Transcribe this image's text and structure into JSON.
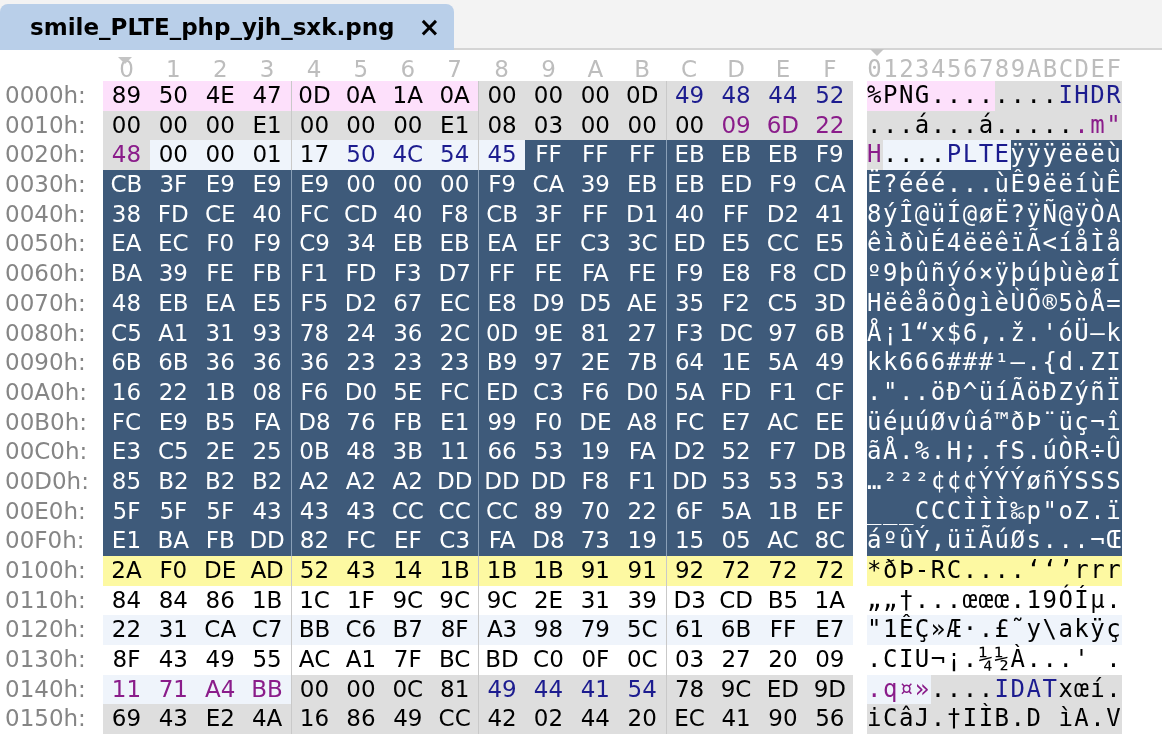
{
  "tab": {
    "title": "smile_PLTE_php_yjh_sxk.png",
    "close": "×",
    "selected": true
  },
  "column_header": {
    "hex": [
      "0",
      "1",
      "2",
      "3",
      "4",
      "5",
      "6",
      "7",
      "8",
      "9",
      "A",
      "B",
      "C",
      "D",
      "E",
      "F"
    ],
    "ascii": "0123456789ABCDEF"
  },
  "rows": [
    {
      "offset": "0000h:",
      "segments": [
        {
          "color": "#fde0fb",
          "selected": false,
          "kind": "plain",
          "bytes": "89 50 4E 47 0D 0A 1A 0A",
          "ascii": "%PNG...."
        },
        {
          "color": "#dedede",
          "selected": false,
          "kind": "plain",
          "bytes": "00 00 00 0D",
          "ascii": "...."
        },
        {
          "color": "#dedede",
          "selected": false,
          "kind": "type",
          "bytes": "49 48 44 52",
          "ascii": "IHDR"
        }
      ]
    },
    {
      "offset": "0010h:",
      "segments": [
        {
          "color": "#dedede",
          "selected": false,
          "kind": "plain",
          "bytes": "00 00 00 E1 00 00 00 E1 08 03 00 00 00",
          "ascii": "...á...á....."
        },
        {
          "color": "#dedede",
          "selected": false,
          "kind": "crc",
          "bytes": "09 6D 22",
          "ascii": ".m\""
        }
      ]
    },
    {
      "offset": "0020h:",
      "segments": [
        {
          "color": "#dedede",
          "selected": false,
          "kind": "crc",
          "bytes": "48",
          "ascii": "H"
        },
        {
          "color": "#eff4fb",
          "selected": false,
          "kind": "plain",
          "bytes": "00 00 01 17",
          "ascii": "...."
        },
        {
          "color": "#eff4fb",
          "selected": false,
          "kind": "type",
          "bytes": "50 4C 54 45",
          "ascii": "PLTE"
        },
        {
          "color": "#3e5a7a",
          "selected": true,
          "kind": "plain",
          "bytes": "FF FF FF EB EB EB F9",
          "ascii": "ÿÿÿëëëù"
        }
      ]
    },
    {
      "offset": "0030h:",
      "segments": [
        {
          "color": "#3e5a7a",
          "selected": true,
          "kind": "plain",
          "bytes": "CB 3F E9 E9 E9 00 00 00 F9 CA 39 EB EB ED F9 CA",
          "ascii": "Ë?ééé...ùÊ9ëëíùÊ"
        }
      ]
    },
    {
      "offset": "0040h:",
      "segments": [
        {
          "color": "#3e5a7a",
          "selected": true,
          "kind": "plain",
          "bytes": "38 FD CE 40 FC CD 40 F8 CB 3F FF D1 40 FF D2 41",
          "ascii": "8ýÎ@üÍ@øË?ÿÑ@ÿÒA"
        }
      ]
    },
    {
      "offset": "0050h:",
      "segments": [
        {
          "color": "#3e5a7a",
          "selected": true,
          "kind": "plain",
          "bytes": "EA EC F0 F9 C9 34 EB EB EA EF C3 3C ED E5 CC E5",
          "ascii": "êìðùÉ4ëëêïÃ<íåÌå"
        }
      ]
    },
    {
      "offset": "0060h:",
      "segments": [
        {
          "color": "#3e5a7a",
          "selected": true,
          "kind": "plain",
          "bytes": "BA 39 FE FB F1 FD F3 D7 FF FE FA FE F9 E8 F8 CD",
          "ascii": "º9þûñýó×ÿþúþùèøÍ"
        }
      ]
    },
    {
      "offset": "0070h:",
      "segments": [
        {
          "color": "#3e5a7a",
          "selected": true,
          "kind": "plain",
          "bytes": "48 EB EA E5 F5 D2 67 EC E8 D9 D5 AE 35 F2 C5 3D",
          "ascii": "HëêåõÒgìèÙÕ®5òÅ="
        }
      ]
    },
    {
      "offset": "0080h:",
      "segments": [
        {
          "color": "#3e5a7a",
          "selected": true,
          "kind": "plain",
          "bytes": "C5 A1 31 93 78 24 36 2C 0D 9E 81 27 F3 DC 97 6B",
          "ascii": "Å¡1“x$6,.ž.'óÜ—k"
        }
      ]
    },
    {
      "offset": "0090h:",
      "segments": [
        {
          "color": "#3e5a7a",
          "selected": true,
          "kind": "plain",
          "bytes": "6B 6B 36 36 36 23 23 23 B9 97 2E 7B 64 1E 5A 49",
          "ascii": "kk666###¹—.{d.ZI"
        }
      ]
    },
    {
      "offset": "00A0h:",
      "segments": [
        {
          "color": "#3e5a7a",
          "selected": true,
          "kind": "plain",
          "bytes": "16 22 1B 08 F6 D0 5E FC ED C3 F6 D0 5A FD F1 CF",
          "ascii": ".\"..öÐ^üíÃöÐZýñÏ"
        }
      ]
    },
    {
      "offset": "00B0h:",
      "segments": [
        {
          "color": "#3e5a7a",
          "selected": true,
          "kind": "plain",
          "bytes": "FC E9 B5 FA D8 76 FB E1 99 F0 DE A8 FC E7 AC EE",
          "ascii": "üéµúØvûá™ðÞ¨üç¬î"
        }
      ]
    },
    {
      "offset": "00C0h:",
      "segments": [
        {
          "color": "#3e5a7a",
          "selected": true,
          "kind": "plain",
          "bytes": "E3 C5 2E 25 0B 48 3B 11 66 53 19 FA D2 52 F7 DB",
          "ascii": "ãÅ.%.H;.fS.úÒR÷Û"
        }
      ]
    },
    {
      "offset": "00D0h:",
      "segments": [
        {
          "color": "#3e5a7a",
          "selected": true,
          "kind": "plain",
          "bytes": "85 B2 B2 B2 A2 A2 A2 DD DD DD F8 F1 DD 53 53 53",
          "ascii": "…²²²¢¢¢ÝÝÝøñÝSSS"
        }
      ]
    },
    {
      "offset": "00E0h:",
      "segments": [
        {
          "color": "#3e5a7a",
          "selected": true,
          "kind": "plain",
          "bytes": "5F 5F 5F 43 43 43 CC CC CC 89 70 22 6F 5A 1B EF",
          "ascii": "___CCCÌÌÌ‰p\"oZ.ï"
        }
      ]
    },
    {
      "offset": "00F0h:",
      "segments": [
        {
          "color": "#3e5a7a",
          "selected": true,
          "kind": "plain",
          "bytes": "E1 BA FB DD 82 FC EF C3 FA D8 73 19 15 05 AC 8C",
          "ascii": "áºûÝ‚üïÃúØs...¬Œ"
        }
      ]
    },
    {
      "offset": "0100h:",
      "segments": [
        {
          "color": "#fdf9a2",
          "selected": false,
          "kind": "plain",
          "bytes": "2A F0 DE AD 52 43 14 1B 1B 1B 91 91 92 72 72 72",
          "ascii": "*ðÞ-RC....‘‘’rrr"
        }
      ]
    },
    {
      "offset": "0110h:",
      "segments": [
        {
          "color": "#ffffff",
          "selected": false,
          "kind": "plain",
          "bytes": "84 84 86 1B 1C 1F 9C 9C 9C 2E 31 39 D3 CD B5 1A",
          "ascii": "„„†...œœœ.19ÓÍµ."
        }
      ]
    },
    {
      "offset": "0120h:",
      "segments": [
        {
          "color": "#eff4fb",
          "selected": false,
          "kind": "plain",
          "bytes": "22 31 CA C7 BB C6 B7 8F A3 98 79 5C 61 6B FF E7",
          "ascii": "\"1ÊÇ»Æ·.£˜y\\akÿç"
        }
      ]
    },
    {
      "offset": "0130h:",
      "segments": [
        {
          "color": "#ffffff",
          "selected": false,
          "kind": "plain",
          "bytes": "8F 43 49 55 AC A1 7F BC BD C0 0F 0C 03 27 20 09",
          "ascii": ".CIU¬¡.¼½À...' ."
        }
      ]
    },
    {
      "offset": "0140h:",
      "segments": [
        {
          "color": "#eff4fb",
          "selected": false,
          "kind": "crc",
          "bytes": "11 71 A4 BB",
          "ascii": ".q¤»"
        },
        {
          "color": "#dedede",
          "selected": false,
          "kind": "plain",
          "bytes": "00 00 0C 81",
          "ascii": "...."
        },
        {
          "color": "#dedede",
          "selected": false,
          "kind": "type",
          "bytes": "49 44 41 54",
          "ascii": "IDAT"
        },
        {
          "color": "#dedede",
          "selected": false,
          "kind": "plain",
          "bytes": "78 9C ED 9D",
          "ascii": "xœí."
        }
      ]
    },
    {
      "offset": "0150h:",
      "segments": [
        {
          "color": "#dedede",
          "selected": false,
          "kind": "plain",
          "bytes": "69 43 E2 4A 16 86 49 CC 42 02 44 20 EC 41 90 56",
          "ascii": "iCâJ.†IÌB.D ìA.V"
        }
      ]
    }
  ]
}
